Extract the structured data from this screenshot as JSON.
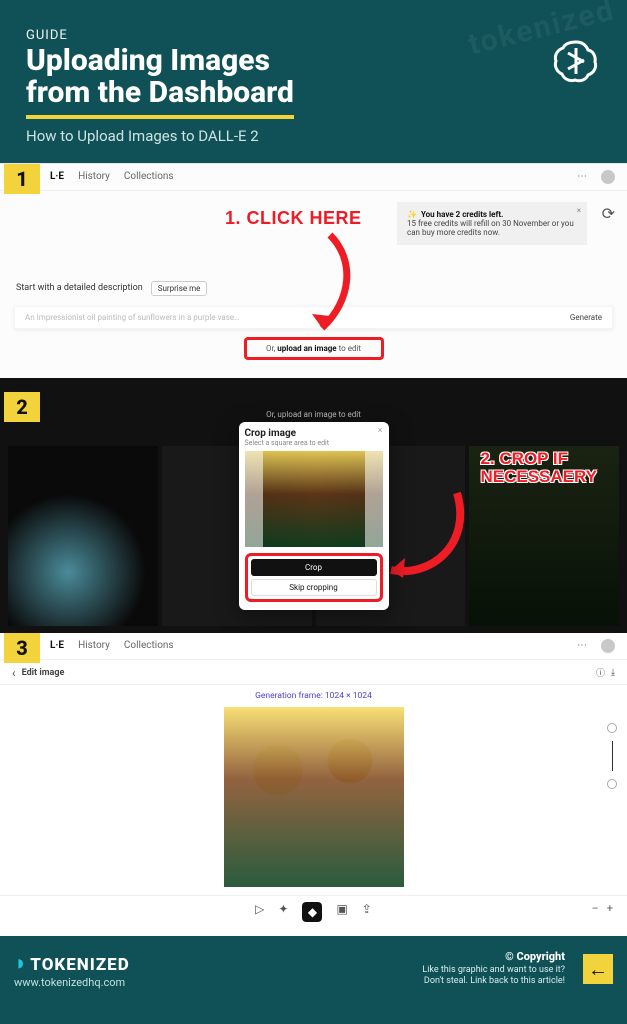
{
  "header": {
    "guide_label": "GUIDE",
    "title_line1": "Uploading Images",
    "title_line2": "from the Dashboard",
    "subtitle": "How to Upload Images to DALL-E 2"
  },
  "step1": {
    "badge": "1",
    "nav_brand": "L·E",
    "nav_history": "History",
    "nav_collections": "Collections",
    "credits_title": "You have 2 credits left.",
    "credits_body": "15 free credits will refill on 30 November or you can buy more credits now.",
    "start_label": "Start with a detailed description",
    "surprise": "Surprise me",
    "prompt_placeholder": "An Impressionist oil painting of sunflowers in a purple vase…",
    "generate": "Generate",
    "upload_prefix": "Or, ",
    "upload_bold": "upload an image",
    "upload_suffix": " to edit",
    "annotation": "1. CLICK HERE"
  },
  "step2": {
    "badge": "2",
    "hint": "Or, upload an image to edit",
    "modal_title": "Crop image",
    "modal_sub": "Select a square area to edit",
    "btn_crop": "Crop",
    "btn_skip": "Skip cropping",
    "annotation_l1": "2. CROP IF",
    "annotation_l2": "NECESSAERY"
  },
  "step3": {
    "badge": "3",
    "nav_brand": "L·E",
    "nav_history": "History",
    "nav_collections": "Collections",
    "back": "‹",
    "edit_label": "Edit image",
    "frame_label": "Generation frame: 1024 × 1024",
    "zoom_minus": "–",
    "zoom_plus": "+"
  },
  "footer": {
    "brand": "TOKENIZED",
    "url": "www.tokenizedhq.com",
    "copyright": "© Copyright",
    "line1": "Like this graphic and want to use it?",
    "line2": "Don't steal. Link back to this article!",
    "arrow": "←"
  }
}
